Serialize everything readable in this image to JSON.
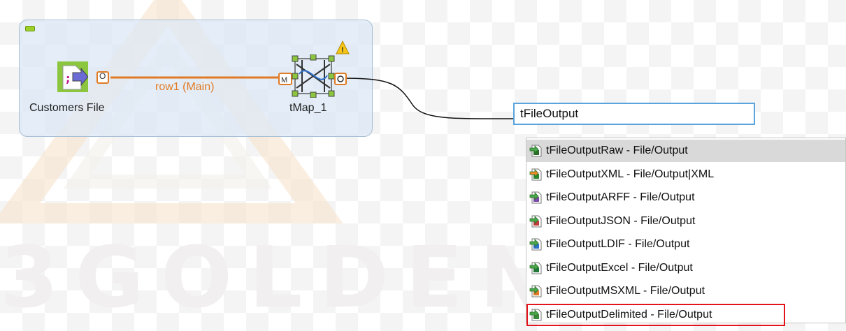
{
  "watermark": {
    "text": "3GOLDEN 金"
  },
  "subjob": {
    "components": {
      "customers_file": {
        "label": "Customers File",
        "port_out": "O"
      },
      "tmap": {
        "label": "tMap_1",
        "port_in": "M",
        "port_out": "O"
      }
    },
    "connection": {
      "label": "row1 (Main)"
    }
  },
  "search": {
    "value": "tFileOutput"
  },
  "dropdown": {
    "items": [
      {
        "label": "tFileOutputRaw - File/Output",
        "icon": "file-raw-icon",
        "state": "hover"
      },
      {
        "label": "tFileOutputXML - File/Output|XML",
        "icon": "file-xml-icon",
        "state": "normal"
      },
      {
        "label": "tFileOutputARFF - File/Output",
        "icon": "file-arff-icon",
        "state": "normal"
      },
      {
        "label": "tFileOutputJSON - File/Output",
        "icon": "file-json-icon",
        "state": "normal"
      },
      {
        "label": "tFileOutputLDIF - File/Output",
        "icon": "file-ldif-icon",
        "state": "normal"
      },
      {
        "label": "tFileOutputExcel - File/Output",
        "icon": "file-excel-icon",
        "state": "normal"
      },
      {
        "label": "tFileOutputMSXML - File/Output",
        "icon": "file-msxml-icon",
        "state": "normal"
      },
      {
        "label": "tFileOutputDelimited - File/Output",
        "icon": "file-delimited-icon",
        "state": "selected"
      }
    ]
  },
  "colors": {
    "accent_orange": "#e07a24",
    "selection_red": "#e3141c",
    "input_border": "#5aa3dd",
    "hover_gray": "#d9d9d9"
  }
}
